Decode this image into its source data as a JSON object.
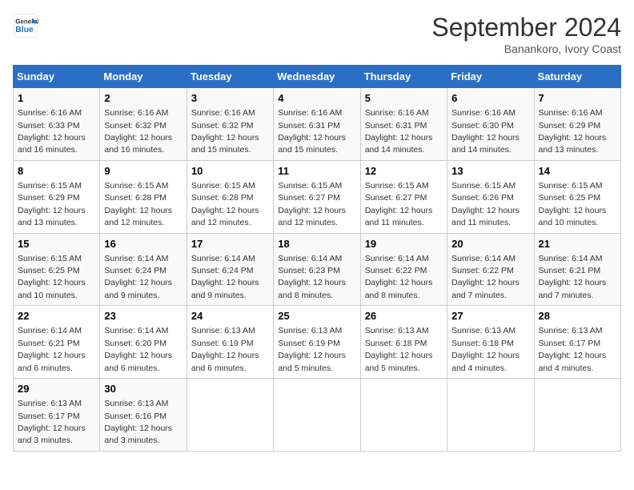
{
  "header": {
    "logo_line1": "General",
    "logo_line2": "Blue",
    "month": "September 2024",
    "location": "Banankoro, Ivory Coast"
  },
  "weekdays": [
    "Sunday",
    "Monday",
    "Tuesday",
    "Wednesday",
    "Thursday",
    "Friday",
    "Saturday"
  ],
  "weeks": [
    [
      {
        "day": "1",
        "detail": "Sunrise: 6:16 AM\nSunset: 6:33 PM\nDaylight: 12 hours\nand 16 minutes."
      },
      {
        "day": "2",
        "detail": "Sunrise: 6:16 AM\nSunset: 6:32 PM\nDaylight: 12 hours\nand 16 minutes."
      },
      {
        "day": "3",
        "detail": "Sunrise: 6:16 AM\nSunset: 6:32 PM\nDaylight: 12 hours\nand 15 minutes."
      },
      {
        "day": "4",
        "detail": "Sunrise: 6:16 AM\nSunset: 6:31 PM\nDaylight: 12 hours\nand 15 minutes."
      },
      {
        "day": "5",
        "detail": "Sunrise: 6:16 AM\nSunset: 6:31 PM\nDaylight: 12 hours\nand 14 minutes."
      },
      {
        "day": "6",
        "detail": "Sunrise: 6:16 AM\nSunset: 6:30 PM\nDaylight: 12 hours\nand 14 minutes."
      },
      {
        "day": "7",
        "detail": "Sunrise: 6:16 AM\nSunset: 6:29 PM\nDaylight: 12 hours\nand 13 minutes."
      }
    ],
    [
      {
        "day": "8",
        "detail": "Sunrise: 6:15 AM\nSunset: 6:29 PM\nDaylight: 12 hours\nand 13 minutes."
      },
      {
        "day": "9",
        "detail": "Sunrise: 6:15 AM\nSunset: 6:28 PM\nDaylight: 12 hours\nand 12 minutes."
      },
      {
        "day": "10",
        "detail": "Sunrise: 6:15 AM\nSunset: 6:28 PM\nDaylight: 12 hours\nand 12 minutes."
      },
      {
        "day": "11",
        "detail": "Sunrise: 6:15 AM\nSunset: 6:27 PM\nDaylight: 12 hours\nand 12 minutes."
      },
      {
        "day": "12",
        "detail": "Sunrise: 6:15 AM\nSunset: 6:27 PM\nDaylight: 12 hours\nand 11 minutes."
      },
      {
        "day": "13",
        "detail": "Sunrise: 6:15 AM\nSunset: 6:26 PM\nDaylight: 12 hours\nand 11 minutes."
      },
      {
        "day": "14",
        "detail": "Sunrise: 6:15 AM\nSunset: 6:25 PM\nDaylight: 12 hours\nand 10 minutes."
      }
    ],
    [
      {
        "day": "15",
        "detail": "Sunrise: 6:15 AM\nSunset: 6:25 PM\nDaylight: 12 hours\nand 10 minutes."
      },
      {
        "day": "16",
        "detail": "Sunrise: 6:14 AM\nSunset: 6:24 PM\nDaylight: 12 hours\nand 9 minutes."
      },
      {
        "day": "17",
        "detail": "Sunrise: 6:14 AM\nSunset: 6:24 PM\nDaylight: 12 hours\nand 9 minutes."
      },
      {
        "day": "18",
        "detail": "Sunrise: 6:14 AM\nSunset: 6:23 PM\nDaylight: 12 hours\nand 8 minutes."
      },
      {
        "day": "19",
        "detail": "Sunrise: 6:14 AM\nSunset: 6:22 PM\nDaylight: 12 hours\nand 8 minutes."
      },
      {
        "day": "20",
        "detail": "Sunrise: 6:14 AM\nSunset: 6:22 PM\nDaylight: 12 hours\nand 7 minutes."
      },
      {
        "day": "21",
        "detail": "Sunrise: 6:14 AM\nSunset: 6:21 PM\nDaylight: 12 hours\nand 7 minutes."
      }
    ],
    [
      {
        "day": "22",
        "detail": "Sunrise: 6:14 AM\nSunset: 6:21 PM\nDaylight: 12 hours\nand 6 minutes."
      },
      {
        "day": "23",
        "detail": "Sunrise: 6:14 AM\nSunset: 6:20 PM\nDaylight: 12 hours\nand 6 minutes."
      },
      {
        "day": "24",
        "detail": "Sunrise: 6:13 AM\nSunset: 6:19 PM\nDaylight: 12 hours\nand 6 minutes."
      },
      {
        "day": "25",
        "detail": "Sunrise: 6:13 AM\nSunset: 6:19 PM\nDaylight: 12 hours\nand 5 minutes."
      },
      {
        "day": "26",
        "detail": "Sunrise: 6:13 AM\nSunset: 6:18 PM\nDaylight: 12 hours\nand 5 minutes."
      },
      {
        "day": "27",
        "detail": "Sunrise: 6:13 AM\nSunset: 6:18 PM\nDaylight: 12 hours\nand 4 minutes."
      },
      {
        "day": "28",
        "detail": "Sunrise: 6:13 AM\nSunset: 6:17 PM\nDaylight: 12 hours\nand 4 minutes."
      }
    ],
    [
      {
        "day": "29",
        "detail": "Sunrise: 6:13 AM\nSunset: 6:17 PM\nDaylight: 12 hours\nand 3 minutes."
      },
      {
        "day": "30",
        "detail": "Sunrise: 6:13 AM\nSunset: 6:16 PM\nDaylight: 12 hours\nand 3 minutes."
      },
      null,
      null,
      null,
      null,
      null
    ]
  ]
}
